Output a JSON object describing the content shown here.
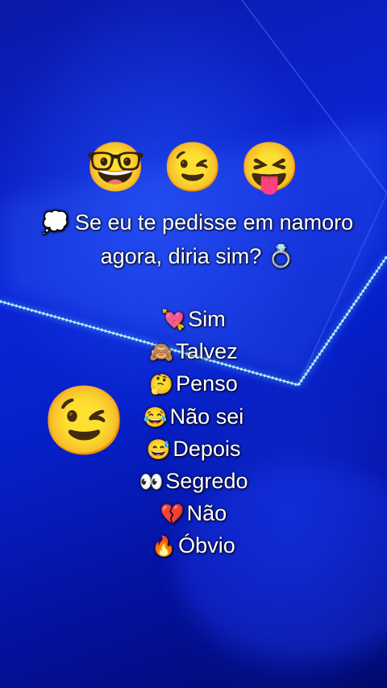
{
  "top_emojis": {
    "nerd": "🤓",
    "wink": "😉",
    "tongue": "😝"
  },
  "question": {
    "icon": "💭",
    "text": "Se eu te pedisse em namoro agora, diria sim?",
    "ring": "💍"
  },
  "options": [
    {
      "icon": "💘",
      "label": "Sim"
    },
    {
      "icon": "🙈",
      "label": "Talvez"
    },
    {
      "icon": "🤔",
      "label": "Penso"
    },
    {
      "icon": "😂",
      "label": "Não sei"
    },
    {
      "icon": "😅",
      "label": "Depois"
    },
    {
      "icon": "👀",
      "label": "Segredo"
    },
    {
      "icon": "💔",
      "label": "Não"
    },
    {
      "icon": "🔥",
      "label": "Óbvio"
    }
  ],
  "side_emoji": "😉",
  "colors": {
    "background": "#0b25d6",
    "neon_line": "#7fe6ff",
    "text": "#ffffff"
  }
}
